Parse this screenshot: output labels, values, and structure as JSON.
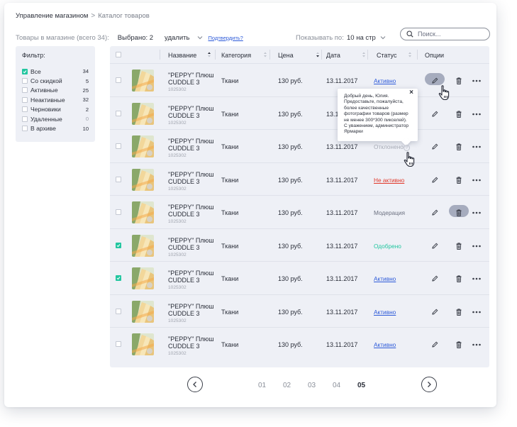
{
  "breadcrumb": {
    "root": "Управление магазином",
    "separator": ">",
    "current": "Каталог товаров"
  },
  "toolbar": {
    "products_total": "Товары в магазине (всего 34):",
    "selected": "Выбрано: 2",
    "delete_action": "удалить",
    "confirm_link": "Подтвердить?",
    "show_label": "Показывать по:",
    "per_page": "10 на стр",
    "search_placeholder": "Поиск..."
  },
  "filter": {
    "title": "Фильтр:",
    "items": [
      {
        "label": "Все",
        "count": "34",
        "checked": true
      },
      {
        "label": "Со скидкой",
        "count": "5",
        "checked": false
      },
      {
        "label": "Активные",
        "count": "25",
        "checked": false
      },
      {
        "label": "Неактивные",
        "count": "32",
        "checked": false
      },
      {
        "label": "Черновики",
        "count": "2",
        "checked": false
      },
      {
        "label": "Удаленные",
        "count": "0",
        "checked": false
      },
      {
        "label": "В архиве",
        "count": "10",
        "checked": false
      }
    ]
  },
  "table": {
    "headers": {
      "name": "Название",
      "category": "Категория",
      "price": "Цена",
      "date": "Дата",
      "status": "Статус",
      "options": "Опции"
    },
    "rows": [
      {
        "name": "\"PEPPY\" Плюш CUDDLE 3",
        "sku": "1025302",
        "category": "Ткани",
        "price": "130 руб.",
        "date": "13.11.2017",
        "status": "Активно",
        "status_type": "active",
        "checked": false,
        "highlight": "edit"
      },
      {
        "name": "\"PEPPY\" Плюш CUDDLE 3",
        "sku": "1025302",
        "category": "Ткани",
        "price": "130 руб.",
        "date": "13.11.2017",
        "status": "",
        "status_type": "",
        "checked": false,
        "highlight": ""
      },
      {
        "name": "\"PEPPY\" Плюш CUDDLE 3",
        "sku": "1025302",
        "category": "Ткани",
        "price": "130 руб.",
        "date": "13.11.2017",
        "status": "Отклонено",
        "status_type": "rejected",
        "checked": false,
        "highlight": ""
      },
      {
        "name": "\"PEPPY\" Плюш CUDDLE 3",
        "sku": "1025302",
        "category": "Ткани",
        "price": "130 руб.",
        "date": "13.11.2017",
        "status": "Не активно",
        "status_type": "inactive",
        "checked": false,
        "highlight": ""
      },
      {
        "name": "\"PEPPY\" Плюш CUDDLE 3",
        "sku": "1025302",
        "category": "Ткани",
        "price": "130 руб.",
        "date": "13.11.2017",
        "status": "Модерация",
        "status_type": "moderation",
        "checked": false,
        "highlight": "trash"
      },
      {
        "name": "\"PEPPY\" Плюш CUDDLE 3",
        "sku": "1025302",
        "category": "Ткани",
        "price": "130 руб.",
        "date": "13.11.2017",
        "status": "Одобрено",
        "status_type": "approved",
        "checked": true,
        "highlight": ""
      },
      {
        "name": "\"PEPPY\" Плюш CUDDLE 3",
        "sku": "1025302",
        "category": "Ткани",
        "price": "130 руб.",
        "date": "13.11.2017",
        "status": "Активно",
        "status_type": "active",
        "checked": true,
        "highlight": ""
      },
      {
        "name": "\"PEPPY\" Плюш CUDDLE 3",
        "sku": "1025302",
        "category": "Ткани",
        "price": "130 руб.",
        "date": "13.11.2017",
        "status": "Активно",
        "status_type": "active",
        "checked": false,
        "highlight": ""
      },
      {
        "name": "\"PEPPY\" Плюш CUDDLE 3",
        "sku": "1025302",
        "category": "Ткани",
        "price": "130 руб.",
        "date": "13.11.2017",
        "status": "Активно",
        "status_type": "active",
        "checked": false,
        "highlight": ""
      }
    ]
  },
  "tooltip": {
    "close": "×",
    "text": "Добрый день, Юлия. Предоставьте, пожалуйста, более качественные фотографии товаров (размер не менее 300*300 пикселей). С уважением, администратор Ярмарки"
  },
  "pagination": {
    "pages": [
      "01",
      "02",
      "03",
      "04",
      "05"
    ],
    "current": "05"
  },
  "icons": {
    "checkbox_checked": "checkmark-icon",
    "edit": "pencil-icon",
    "delete": "trash-icon",
    "more": "more-dots-icon",
    "search": "search-icon",
    "cursor": "hand-pointer-icon"
  },
  "colors": {
    "accent_green": "#23c6a0",
    "link_blue": "#2e5bd9",
    "error_red": "#e0392b",
    "panel_bg": "#eef0f6",
    "highlight_pill": "#a6acbe"
  }
}
